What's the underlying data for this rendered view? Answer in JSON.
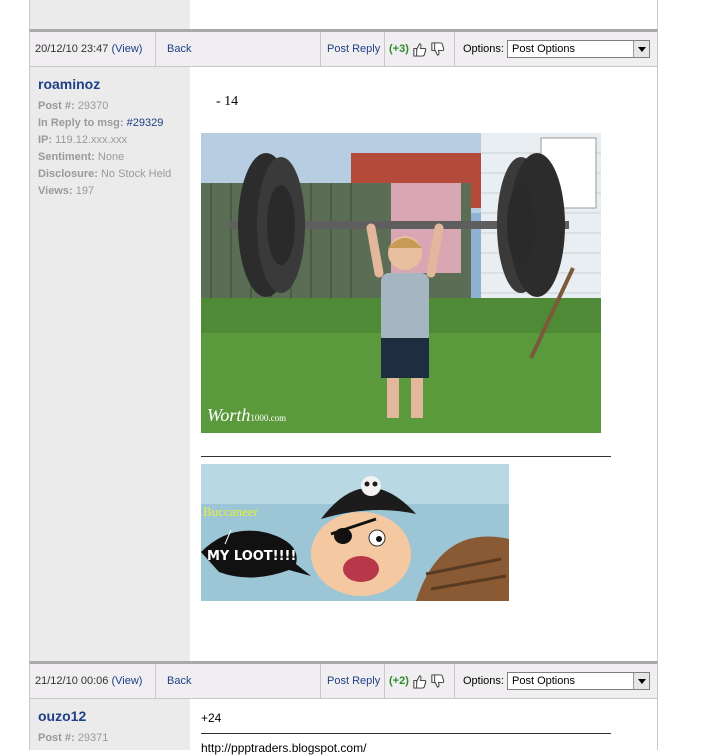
{
  "posts": [
    {
      "date": "20/12/10 23:47",
      "view_label": "(View)",
      "back_label": "Back",
      "post_reply_label": "Post Reply",
      "rating": "(+3)",
      "options_label": "Options:",
      "options_select": "Post Options",
      "username": "roaminoz",
      "meta": {
        "post_no_label": "Post #:",
        "post_no": "29370",
        "in_reply_label": "In Reply to msg:",
        "in_reply_value": "#29329",
        "ip_label": "IP:",
        "ip": "119.12.xxx.xxx",
        "sentiment_label": "Sentiment:",
        "sentiment": "None",
        "disclosure_label": "Disclosure:",
        "disclosure": "No Stock Held",
        "views_label": "Views:",
        "views": "197"
      },
      "body_text": "- 14",
      "image1_watermark": "Worth",
      "image1_watermark_small": "1000.com",
      "image2_text_buccaneer": "Buccaneer",
      "image2_text_loot": "MY LOOT!!!!"
    },
    {
      "date": "21/12/10 00:06",
      "view_label": "(View)",
      "back_label": "Back",
      "post_reply_label": "Post Reply",
      "rating": "(+2)",
      "options_label": "Options:",
      "options_select": "Post Options",
      "username": "ouzo12",
      "meta": {
        "post_no_label": "Post #:",
        "post_no": "29371"
      },
      "body_text": "+24",
      "link_text": "http://ppptraders.blogspot.com/"
    }
  ],
  "colors": {
    "link": "#1f3f86",
    "rating_green": "#2e8b2e",
    "sidebar_bg": "#ebebeb",
    "toolbar_bg": "#f0eef0"
  },
  "icons": [
    "thumbs-up-icon",
    "thumbs-down-icon",
    "dropdown-arrow-icon"
  ]
}
